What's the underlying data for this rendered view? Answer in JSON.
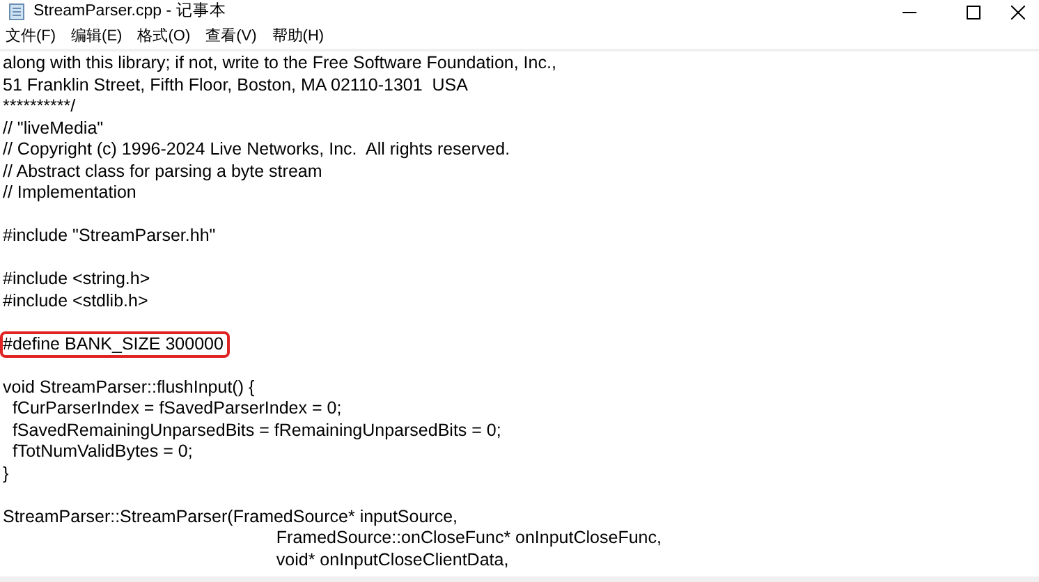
{
  "window": {
    "title": "StreamParser.cpp - 记事本"
  },
  "menu": [
    "文件(F)",
    "编辑(E)",
    "格式(O)",
    "查看(V)",
    "帮助(H)"
  ],
  "lines": [
    {
      "kind": "text",
      "text": "along with this library; if not, write to the Free Software Foundation, Inc.,",
      "marked": false
    },
    {
      "kind": "text",
      "text": "51 Franklin Street, Fifth Floor, Boston, MA 02110-1301  USA",
      "marked": false
    },
    {
      "kind": "text",
      "text": "**********/",
      "marked": false
    },
    {
      "kind": "text",
      "text": "// \"liveMedia\"",
      "marked": false
    },
    {
      "kind": "text",
      "text": "// Copyright (c) 1996-2024 Live Networks, Inc.  All rights reserved.",
      "marked": false
    },
    {
      "kind": "text",
      "text": "// Abstract class for parsing a byte stream",
      "marked": false
    },
    {
      "kind": "text",
      "text": "// Implementation",
      "marked": false
    },
    {
      "kind": "blank"
    },
    {
      "kind": "text",
      "text": "#include \"StreamParser.hh\"",
      "marked": false
    },
    {
      "kind": "blank"
    },
    {
      "kind": "text",
      "text": "#include <string.h>",
      "marked": false
    },
    {
      "kind": "text",
      "text": "#include <stdlib.h>",
      "marked": false
    },
    {
      "kind": "blank"
    },
    {
      "kind": "text",
      "text": "#define BANK_SIZE 300000",
      "marked": true
    },
    {
      "kind": "blank"
    },
    {
      "kind": "text",
      "text": "void StreamParser::flushInput() {",
      "marked": false
    },
    {
      "kind": "text",
      "text": "  fCurParserIndex = fSavedParserIndex = 0;",
      "marked": false
    },
    {
      "kind": "text",
      "text": "  fSavedRemainingUnparsedBits = fRemainingUnparsedBits = 0;",
      "marked": false
    },
    {
      "kind": "text",
      "text": "  fTotNumValidBytes = 0;",
      "marked": false
    },
    {
      "kind": "text",
      "text": "}",
      "marked": false
    },
    {
      "kind": "blank"
    },
    {
      "kind": "text",
      "text": "StreamParser::StreamParser(FramedSource* inputSource,",
      "marked": false
    },
    {
      "kind": "text",
      "text": "\t\t\t\t\t\t   FramedSource::onCloseFunc* onInputCloseFunc,",
      "marked": false
    },
    {
      "kind": "text",
      "text": "\t\t\t\t\t\t   void* onInputCloseClientData,",
      "marked": false
    }
  ]
}
